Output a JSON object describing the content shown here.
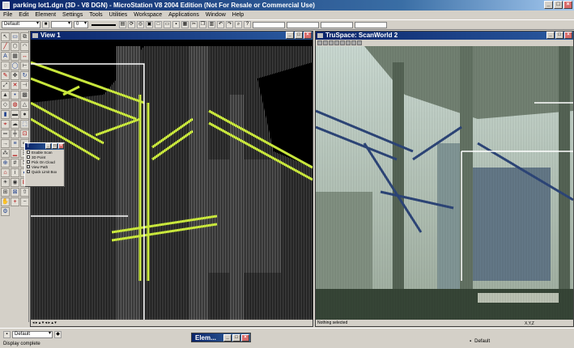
{
  "window": {
    "title": "parking lot1.dgn (3D - V8 DGN) - MicroStation V8 2004 Edition (Not For Resale or Commercial Use)",
    "minimize": "_",
    "maximize": "□",
    "close": "×"
  },
  "menu": [
    "File",
    "Edit",
    "Element",
    "Settings",
    "Tools",
    "Utilities",
    "Workspace",
    "Applications",
    "Window",
    "Help"
  ],
  "toolbar": {
    "level": "Default",
    "weight": "0"
  },
  "views": {
    "left": {
      "title": "View 1",
      "status": ""
    },
    "right": {
      "title": "TruSpace: ScanWorld 2",
      "status": "Nothing selected",
      "coords": "X,Y,Z"
    }
  },
  "dialog": {
    "title": "T",
    "items": [
      "Enable Scan",
      "3D Point",
      "Pick On Cloud",
      "View Path",
      "Quick Limit Box"
    ]
  },
  "statusbar": {
    "level": "Default",
    "message": "Display complete",
    "element_window": "Elem...",
    "right_level": "Default"
  },
  "colors": {
    "title_bar": "#0a246a",
    "steel_highlight": "#c8e63c",
    "window_bg": "#d4d0c8"
  }
}
